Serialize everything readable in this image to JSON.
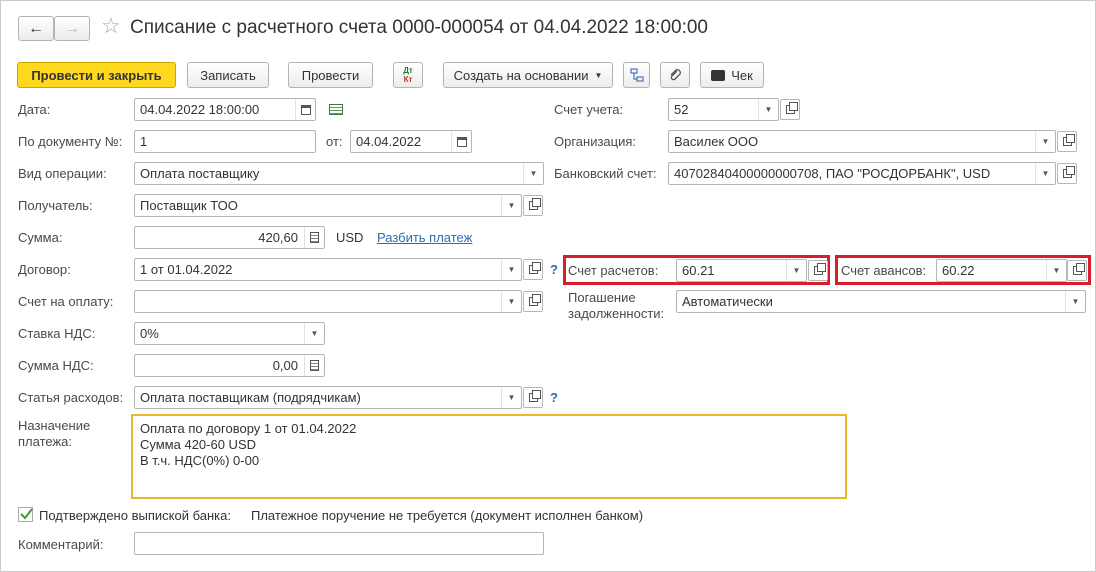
{
  "header": {
    "title": "Списание с расчетного счета 0000-000054 от 04.04.2022 18:00:00",
    "back_glyph": "←",
    "forward_glyph": "→",
    "star_glyph": "☆"
  },
  "toolbar": {
    "post_close": "Провести и закрыть",
    "save": "Записать",
    "post": "Провести",
    "dt_kt_top": "Дт",
    "dt_kt_bottom": "Кт",
    "create_basis": "Создать на основании",
    "check": "Чек"
  },
  "form": {
    "date": {
      "label": "Дата:",
      "value": "04.04.2022 18:00:00"
    },
    "doc_no": {
      "label": "По документу №:",
      "value": "1",
      "from_label": "от:",
      "from_value": "04.04.2022"
    },
    "operation": {
      "label": "Вид операции:",
      "value": "Оплата поставщику"
    },
    "recipient": {
      "label": "Получатель:",
      "value": "Поставщик ТОО"
    },
    "amount": {
      "label": "Сумма:",
      "value": "420,60",
      "currency": "USD",
      "split_link": "Разбить платеж"
    },
    "contract": {
      "label": "Договор:",
      "value": "1 от 01.04.2022"
    },
    "invoice": {
      "label": "Счет на оплату:",
      "value": ""
    },
    "vat_rate": {
      "label": "Ставка НДС:",
      "value": "0%"
    },
    "vat_amount": {
      "label": "Сумма НДС:",
      "value": "0,00"
    },
    "expense": {
      "label": "Статья расходов:",
      "value": "Оплата поставщикам (подрядчикам)"
    },
    "purpose": {
      "label_1": "Назначение",
      "label_2": "платежа:",
      "line_1": "Оплата по договору 1 от 01.04.2022",
      "line_2": "Сумма 420-60 USD",
      "line_3": "В т.ч. НДС(0%) 0-00"
    },
    "account": {
      "label": "Счет учета:",
      "value": "52"
    },
    "organization": {
      "label": "Организация:",
      "value": "Василек ООО"
    },
    "bank_account": {
      "label": "Банковский счет:",
      "value": "40702840400000000708, ПАО \"РОСДОРБАНК\", USD"
    },
    "settlement_account": {
      "label": "Счет расчетов:",
      "value": "60.21"
    },
    "advance_account": {
      "label": "Счет авансов:",
      "value": "60.22"
    },
    "repayment": {
      "label_1": "Погашение",
      "label_2": "задолженности:",
      "value": "Автоматически"
    },
    "confirmed": {
      "label": "Подтверждено выпиской банка:",
      "note": "Платежное поручение не требуется (документ исполнен банком)",
      "checked": true
    },
    "comment": {
      "label": "Комментарий:",
      "value": ""
    },
    "help_glyph": "?",
    "dropdown_glyph": "▼"
  },
  "colors": {
    "primary_button": "#ffd91f",
    "highlight_border": "#d81e2c",
    "focus_border": "#e8b92a",
    "link": "#2b6cb5"
  }
}
